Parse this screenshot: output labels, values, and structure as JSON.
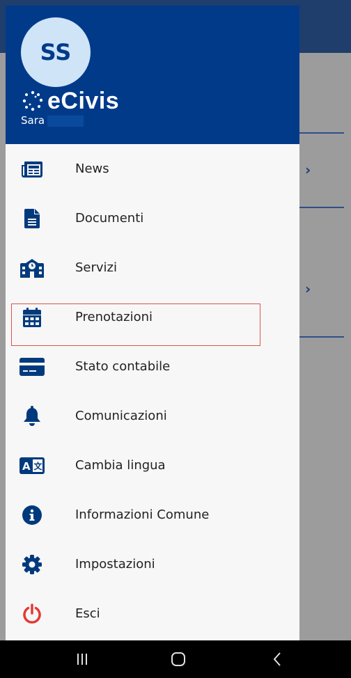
{
  "header": {
    "avatar_initials": "SS",
    "app_name": "eCivis",
    "user_first_name": "Sara"
  },
  "menu": {
    "items": [
      {
        "label": "News",
        "icon": "newspaper-icon"
      },
      {
        "label": "Documenti",
        "icon": "document-icon"
      },
      {
        "label": "Servizi",
        "icon": "school-building-icon"
      },
      {
        "label": "Prenotazioni",
        "icon": "calendar-icon"
      },
      {
        "label": "Stato contabile",
        "icon": "credit-card-icon"
      },
      {
        "label": "Comunicazioni",
        "icon": "bell-icon"
      },
      {
        "label": "Cambia lingua",
        "icon": "language-icon"
      },
      {
        "label": "Informazioni Comune",
        "icon": "info-icon"
      },
      {
        "label": "Impostazioni",
        "icon": "gear-icon"
      },
      {
        "label": "Esci",
        "icon": "power-icon"
      }
    ]
  },
  "colors": {
    "primary": "#023a8a",
    "icon_blue": "#003a7d",
    "logout_red": "#e53935",
    "highlight_border": "#d9534f"
  }
}
